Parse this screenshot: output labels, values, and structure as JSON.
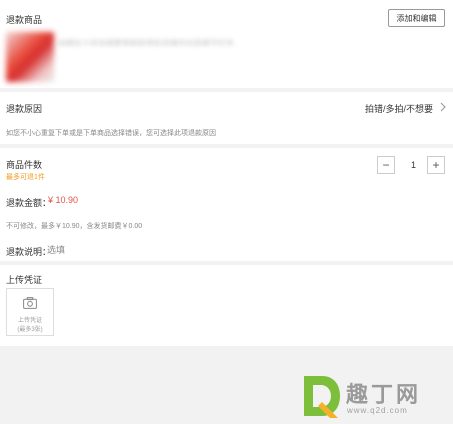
{
  "goods": {
    "title": "退款商品",
    "edit_button": "添加和编辑",
    "name_blurred": "纯棉女士连衣裙夏季新款宽松显瘦中长款裙子红色"
  },
  "reason": {
    "title": "退款原因",
    "value": "拍错/多拍/不想要",
    "hint": "如您不小心重复下单或是下单商品选择错误，您可选择此项退款原因"
  },
  "quantity": {
    "title": "商品件数",
    "max_text": "最多可退1件",
    "minus": "−",
    "value": "1",
    "plus": "+"
  },
  "amount": {
    "label": "退款金额：",
    "value": "¥ 10.90",
    "note": "不可修改，最多￥10.90，含发货邮费￥0.00"
  },
  "explanation": {
    "label": "退款说明：",
    "placeholder": "选填"
  },
  "upload": {
    "title": "上传凭证",
    "label": "上传凭证",
    "limit": "(最多3张)"
  },
  "watermark": {
    "text": "趣丁网",
    "url": "www.q2d.com"
  },
  "colors": {
    "accent_price": "#e0534a",
    "hint_orange": "#f29b1b",
    "watermark_green": "#7dbf3a"
  }
}
